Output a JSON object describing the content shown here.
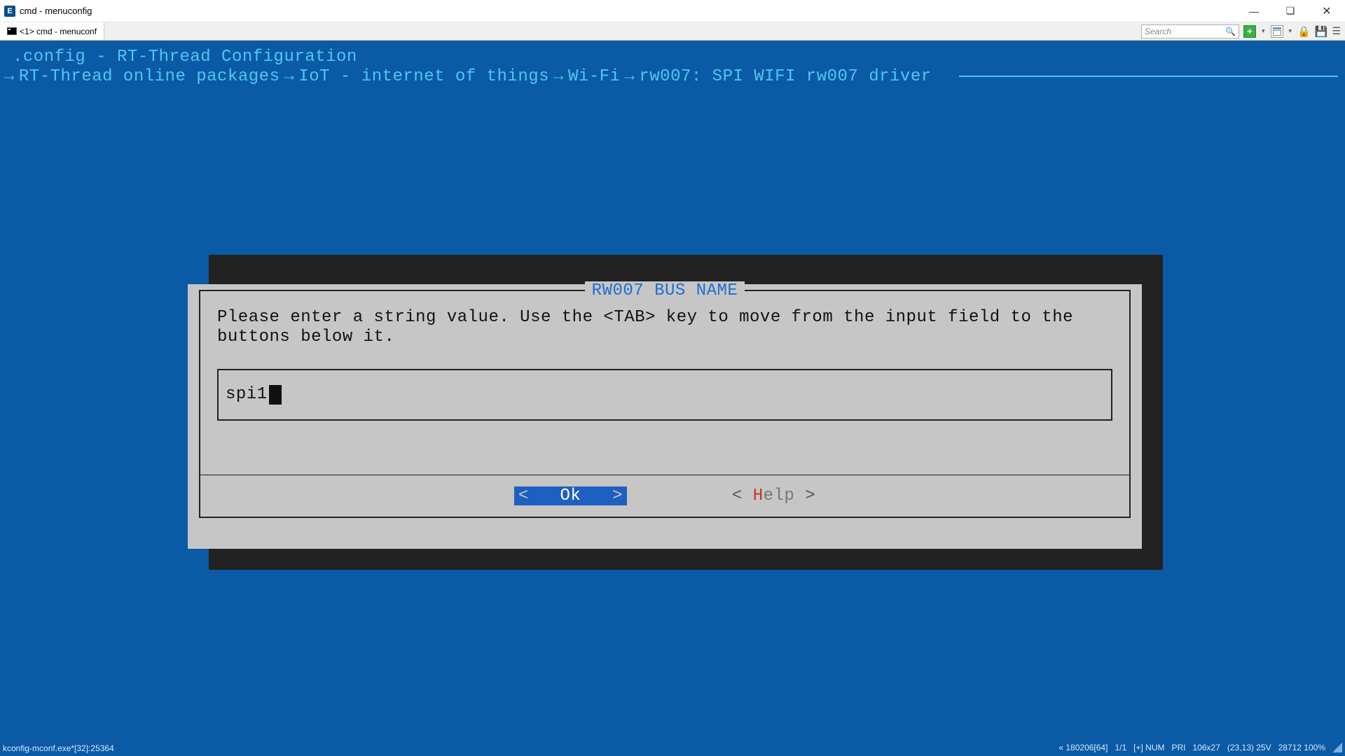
{
  "window": {
    "title": "cmd - menuconfig",
    "app_icon_letter": "E"
  },
  "tab": {
    "label": "<1> cmd - menuconf"
  },
  "toolbar": {
    "search_placeholder": "Search"
  },
  "terminal": {
    "header": ".config - RT-Thread Configuration",
    "breadcrumb": [
      "RT-Thread online packages",
      "IoT - internet of things",
      "Wi-Fi",
      "rw007: SPI WIFI rw007 driver"
    ]
  },
  "dialog": {
    "title": "RW007 BUS NAME",
    "prompt": "Please enter a string value. Use the <TAB> key to move from the input field to the buttons below it.",
    "input_value": "spi1",
    "ok_label": "Ok",
    "help_hotkey": "H",
    "help_rest": "elp"
  },
  "status": {
    "left": "kconfig-mconf.exe*[32]:25364",
    "right": [
      "« 180206[64]",
      "1/1",
      "[+] NUM",
      "PRI",
      "106x27",
      "(23,13) 25V",
      "28712 100%"
    ]
  }
}
